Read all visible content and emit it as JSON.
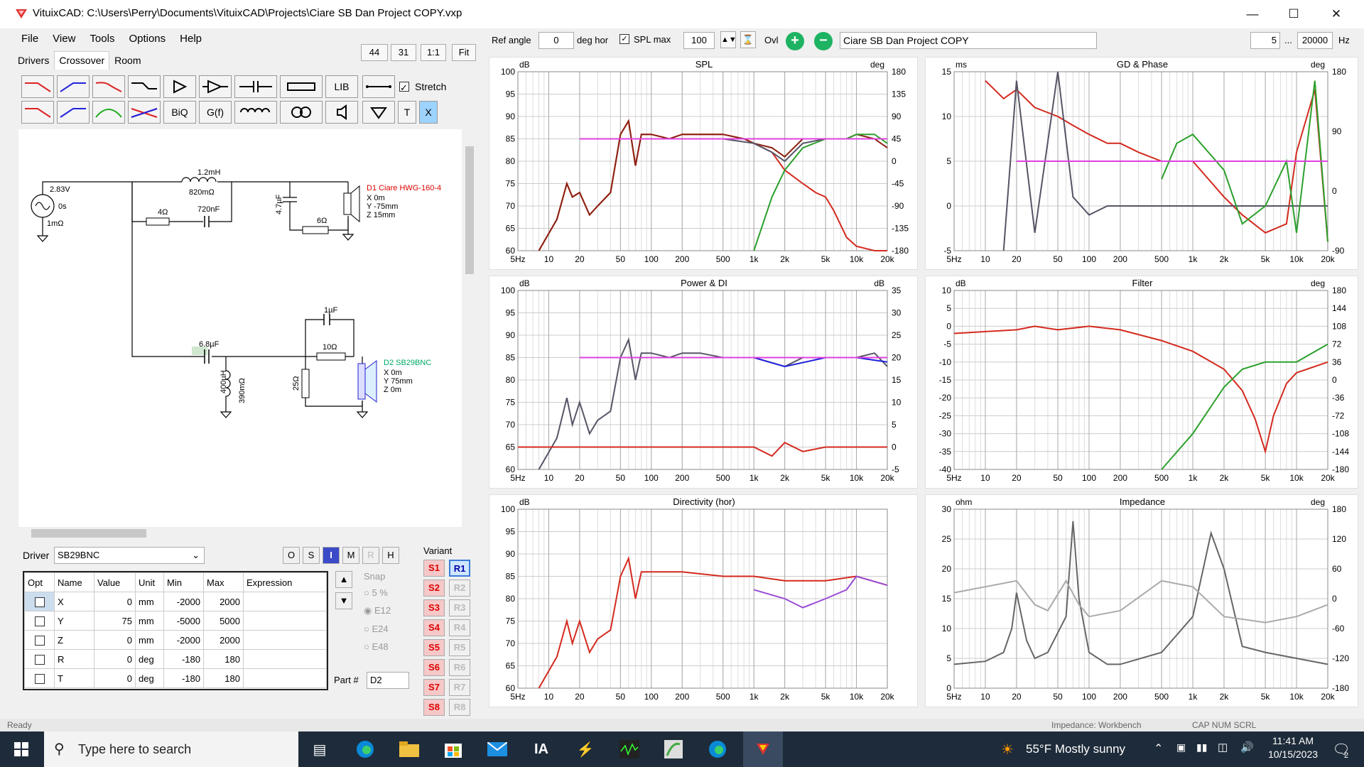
{
  "window": {
    "title": "VituixCAD: C:\\Users\\Perry\\Documents\\VituixCAD\\Projects\\Ciare SB Dan Project COPY.vxp"
  },
  "menu": [
    "File",
    "View",
    "Tools",
    "Options",
    "Help"
  ],
  "tabs": [
    "Drivers",
    "Crossover",
    "Room"
  ],
  "zoom": {
    "a": "44",
    "b": "31",
    "one": "1:1",
    "fit": "Fit"
  },
  "toolbar": {
    "lib": "LIB",
    "stretch": "Stretch",
    "biq": "BiQ",
    "gf": "G(f)",
    "t": "T",
    "x": "X"
  },
  "topbar": {
    "ref_angle_label": "Ref angle",
    "ref_angle_value": "0",
    "deg_hor": "deg hor",
    "spl_max_label": "SPL max",
    "spl_max_value": "100",
    "ovl": "Ovl",
    "project_name": "Ciare SB Dan Project COPY",
    "freq_min": "5",
    "ellipsis": "...",
    "freq_max": "20000",
    "hz": "Hz"
  },
  "schematic": {
    "source": {
      "v": "2.83V",
      "phase": "0s",
      "r": "1mΩ"
    },
    "upper": {
      "l1": "1.2mH",
      "l1r": "820mΩ",
      "r1": "4Ω",
      "c1": "720nF",
      "c2": "4.7µF",
      "r2": "6Ω"
    },
    "d1": {
      "name": "D1 Ciare HWG-160-4",
      "x": "X 0m",
      "y": "Y -75mm",
      "z": "Z 15mm"
    },
    "lower": {
      "c1": "6.8µF",
      "l1": "400µH",
      "l1r": "390mΩ",
      "c2": "1µF",
      "r1": "10Ω",
      "r2": "25Ω"
    },
    "d2": {
      "name": "D2 SB29BNC",
      "x": "X 0m",
      "y": "Y 75mm",
      "z": "Z 0m"
    }
  },
  "driver_panel": {
    "label": "Driver",
    "selected": "SB29BNC",
    "buttons": [
      "O",
      "S",
      "I",
      "M",
      "R",
      "H"
    ]
  },
  "param_table": {
    "headers": [
      "Opt",
      "Name",
      "Value",
      "Unit",
      "Min",
      "Max",
      "Expression"
    ],
    "rows": [
      {
        "name": "X",
        "value": "0",
        "unit": "mm",
        "min": "-2000",
        "max": "2000"
      },
      {
        "name": "Y",
        "value": "75",
        "unit": "mm",
        "min": "-5000",
        "max": "5000"
      },
      {
        "name": "Z",
        "value": "0",
        "unit": "mm",
        "min": "-2000",
        "max": "2000"
      },
      {
        "name": "R",
        "value": "0",
        "unit": "deg",
        "min": "-180",
        "max": "180"
      },
      {
        "name": "T",
        "value": "0",
        "unit": "deg",
        "min": "-180",
        "max": "180"
      }
    ]
  },
  "snap": {
    "label": "Snap",
    "options": [
      "5 %",
      "E12",
      "E24",
      "E48"
    ],
    "selected": "E12"
  },
  "part": {
    "label": "Part #",
    "value": "D2"
  },
  "variant": {
    "label": "Variant",
    "s": [
      "S1",
      "S2",
      "S3",
      "S4",
      "S5",
      "S6",
      "S7",
      "S8"
    ],
    "r": [
      "R1",
      "R2",
      "R3",
      "R4",
      "R5",
      "R6",
      "R7",
      "R8"
    ]
  },
  "status": {
    "left": "Ready",
    "mid": "Impedance: Workbench",
    "right": "CAP  NUM  SCRL"
  },
  "taskbar": {
    "search": "Type here to search",
    "weather": "55°F  Mostly sunny",
    "time": "11:41 AM",
    "date": "10/15/2023",
    "notif": "2"
  },
  "colors": {
    "red": "#d42a1f",
    "green": "#2ca02c",
    "gray": "#555566",
    "magenta": "#e040e0",
    "blue": "#2222dd"
  },
  "chart_data": [
    {
      "type": "line",
      "title": "SPL",
      "ylabel": "dB",
      "y2label": "deg",
      "ylim": [
        60,
        100
      ],
      "y2lim": [
        -180,
        180
      ],
      "xscale": "log",
      "xlim": [
        5,
        20000
      ],
      "xticks": [
        "5Hz",
        "10",
        "20",
        "50",
        "100",
        "200",
        "500",
        "1k",
        "2k",
        "5k",
        "10k",
        "20k"
      ],
      "yticks": [
        "100",
        "95",
        "90",
        "85",
        "80",
        "75",
        "70",
        "65",
        "60"
      ],
      "y2ticks": [
        "180",
        "135",
        "90",
        "45",
        "0",
        "-45",
        "-90",
        "-135",
        "-180"
      ],
      "series": [
        {
          "color": "red",
          "x": [
            8,
            12,
            15,
            17,
            20,
            25,
            30,
            40,
            50,
            60,
            70,
            80,
            100,
            150,
            200,
            300,
            500,
            800,
            1000,
            1500,
            2000,
            3000,
            4000,
            5000,
            6000,
            8000,
            10000,
            15000,
            20000
          ],
          "y": [
            60,
            67,
            75,
            72,
            73,
            68,
            70,
            73,
            86,
            89,
            79,
            86,
            86,
            85,
            86,
            86,
            86,
            85,
            84,
            82,
            78,
            75,
            73,
            72,
            69,
            63,
            61,
            60,
            60
          ]
        },
        {
          "color": "darkred",
          "x": [
            8,
            12,
            15,
            17,
            20,
            25,
            30,
            40,
            50,
            60,
            70,
            80,
            100,
            150,
            200,
            300,
            500,
            800,
            1000,
            1500,
            2000,
            3000,
            5000,
            8000,
            10000,
            15000,
            20000
          ],
          "y": [
            60,
            67,
            75,
            72,
            73,
            68,
            70,
            73,
            86,
            89,
            79,
            86,
            86,
            85,
            86,
            86,
            86,
            85,
            84,
            83,
            81,
            85,
            85,
            85,
            86,
            85,
            83
          ]
        },
        {
          "color": "green",
          "x": [
            1000,
            1500,
            2000,
            3000,
            5000,
            8000,
            10000,
            15000,
            20000
          ],
          "y": [
            60,
            72,
            78,
            83,
            85,
            85,
            86,
            86,
            84
          ]
        },
        {
          "color": "gray",
          "x": [
            500,
            1000,
            1500,
            2000,
            3000,
            5000,
            8000
          ],
          "y": [
            85,
            84,
            82,
            80,
            84,
            85,
            85
          ]
        },
        {
          "color": "magenta",
          "x": [
            20,
            20000
          ],
          "y": [
            85,
            85
          ]
        }
      ]
    },
    {
      "type": "line",
      "title": "GD & Phase",
      "ylabel": "ms",
      "y2label": "deg",
      "ylim": [
        -5,
        15
      ],
      "y2lim": [
        -180,
        180
      ],
      "xscale": "log",
      "xlim": [
        5,
        20000
      ],
      "xticks": [
        "5Hz",
        "10",
        "20",
        "50",
        "100",
        "200",
        "500",
        "1k",
        "2k",
        "5k",
        "10k",
        "20k"
      ],
      "yticks": [
        "15",
        "10",
        "5",
        "0",
        "-5"
      ],
      "y2ticks": [
        "180",
        "90",
        "0",
        "-90"
      ],
      "series": [
        {
          "color": "red",
          "x": [
            10,
            15,
            20,
            30,
            50,
            70,
            100,
            150,
            200,
            300,
            500,
            1000,
            2000,
            3000,
            5000,
            8000,
            10000,
            15000,
            20000
          ],
          "y": [
            14,
            12,
            13,
            11,
            10,
            9,
            8,
            7,
            7,
            6,
            5,
            5,
            1,
            -1,
            -3,
            -2,
            6,
            13,
            -4
          ]
        },
        {
          "color": "gray",
          "x": [
            15,
            20,
            30,
            50,
            70,
            100,
            150,
            200,
            300,
            500,
            1000,
            2000,
            5000,
            10000,
            20000
          ],
          "y": [
            -5,
            14,
            -3,
            15,
            1,
            -1,
            0,
            0,
            0,
            0,
            0,
            0,
            0,
            0,
            0
          ]
        },
        {
          "color": "green",
          "x": [
            500,
            700,
            1000,
            2000,
            3000,
            5000,
            8000,
            10000,
            15000,
            20000
          ],
          "y": [
            3,
            7,
            8,
            4,
            -2,
            0,
            5,
            -3,
            14,
            -4
          ]
        },
        {
          "color": "magenta",
          "x": [
            20,
            20000
          ],
          "y": [
            5,
            5
          ]
        }
      ]
    },
    {
      "type": "line",
      "title": "Power & DI",
      "ylabel": "dB",
      "y2label": "dB",
      "ylim": [
        60,
        100
      ],
      "y2lim": [
        -5,
        35
      ],
      "xscale": "log",
      "xlim": [
        5,
        20000
      ],
      "xticks": [
        "5Hz",
        "10",
        "20",
        "50",
        "100",
        "200",
        "500",
        "1k",
        "2k",
        "5k",
        "10k",
        "20k"
      ],
      "yticks": [
        "100",
        "95",
        "90",
        "85",
        "80",
        "75",
        "70",
        "65",
        "60"
      ],
      "y2ticks": [
        "35",
        "30",
        "25",
        "20",
        "15",
        "10",
        "5",
        "0",
        "-5"
      ],
      "series": [
        {
          "color": "gray",
          "x": [
            8,
            12,
            15,
            17,
            20,
            25,
            30,
            40,
            50,
            60,
            70,
            80,
            100,
            150,
            200,
            300,
            500,
            1000,
            2000,
            3000,
            5000,
            10000,
            15000,
            20000
          ],
          "y": [
            60,
            67,
            76,
            70,
            75,
            68,
            71,
            73,
            85,
            89,
            80,
            86,
            86,
            85,
            86,
            86,
            85,
            85,
            83,
            85,
            85,
            85,
            86,
            83
          ]
        },
        {
          "color": "blue",
          "x": [
            1000,
            2000,
            5000,
            10000,
            20000
          ],
          "y": [
            85,
            83,
            85,
            85,
            84
          ]
        },
        {
          "color": "red",
          "x": [
            5,
            500,
            800,
            1000,
            1500,
            2000,
            3000,
            5000,
            10000,
            20000
          ],
          "y": [
            65,
            65,
            65,
            65,
            63,
            66,
            64,
            65,
            65,
            65
          ]
        },
        {
          "color": "magenta",
          "x": [
            20,
            20000
          ],
          "y": [
            85,
            85
          ]
        }
      ]
    },
    {
      "type": "line",
      "title": "Filter",
      "ylabel": "dB",
      "y2label": "deg",
      "ylim": [
        -40,
        10
      ],
      "y2lim": [
        -180,
        180
      ],
      "xscale": "log",
      "xlim": [
        5,
        20000
      ],
      "xticks": [
        "5Hz",
        "10",
        "20",
        "50",
        "100",
        "200",
        "500",
        "1k",
        "2k",
        "5k",
        "10k",
        "20k"
      ],
      "yticks": [
        "10",
        "5",
        "0",
        "-5",
        "-10",
        "-15",
        "-20",
        "-25",
        "-30",
        "-35",
        "-40"
      ],
      "y2ticks": [
        "180",
        "144",
        "108",
        "72",
        "36",
        "0",
        "-36",
        "-72",
        "-108",
        "-144",
        "-180"
      ],
      "series": [
        {
          "color": "red",
          "x": [
            5,
            20,
            30,
            50,
            100,
            200,
            500,
            1000,
            2000,
            3000,
            4000,
            5000,
            6000,
            8000,
            10000,
            20000
          ],
          "y": [
            -2,
            -1,
            0,
            -1,
            0,
            -1,
            -4,
            -7,
            -12,
            -18,
            -26,
            -35,
            -25,
            -16,
            -13,
            -10
          ]
        },
        {
          "color": "green",
          "x": [
            500,
            1000,
            2000,
            3000,
            5000,
            10000,
            20000
          ],
          "y": [
            -40,
            -30,
            -17,
            -12,
            -10,
            -10,
            -5
          ]
        }
      ]
    },
    {
      "type": "line",
      "title": "Directivity (hor)",
      "ylabel": "dB",
      "ylim": [
        60,
        100
      ],
      "xscale": "log",
      "xlim": [
        5,
        20000
      ],
      "xticks": [
        "5Hz",
        "10",
        "20",
        "50",
        "100",
        "200",
        "500",
        "1k",
        "2k",
        "5k",
        "10k",
        "20k"
      ],
      "yticks": [
        "100",
        "95",
        "90",
        "85",
        "80",
        "75",
        "70",
        "65",
        "60"
      ],
      "series": [
        {
          "color": "red",
          "x": [
            8,
            12,
            15,
            17,
            20,
            25,
            30,
            40,
            50,
            60,
            70,
            80,
            100,
            200,
            500,
            1000,
            2000,
            5000,
            10000,
            20000
          ],
          "y": [
            60,
            67,
            75,
            70,
            75,
            68,
            71,
            73,
            85,
            89,
            80,
            86,
            86,
            86,
            85,
            85,
            84,
            84,
            85,
            83
          ]
        },
        {
          "color": "multi",
          "x": [
            1000,
            2000,
            3000,
            5000,
            8000,
            10000,
            20000
          ],
          "y": [
            82,
            80,
            78,
            80,
            82,
            85,
            83
          ]
        }
      ]
    },
    {
      "type": "line",
      "title": "Impedance",
      "ylabel": "ohm",
      "y2label": "deg",
      "ylim": [
        0,
        30
      ],
      "y2lim": [
        -180,
        180
      ],
      "xscale": "log",
      "xlim": [
        5,
        20000
      ],
      "xticks": [
        "5Hz",
        "10",
        "20",
        "50",
        "100",
        "200",
        "500",
        "1k",
        "2k",
        "5k",
        "10k",
        "20k"
      ],
      "yticks": [
        "30",
        "25",
        "20",
        "15",
        "10",
        "5",
        "0"
      ],
      "y2ticks": [
        "180",
        "120",
        "60",
        "0",
        "-60",
        "-120",
        "-180"
      ],
      "series": [
        {
          "color": "darkgray",
          "x": [
            5,
            10,
            15,
            18,
            20,
            25,
            30,
            40,
            60,
            70,
            80,
            100,
            150,
            200,
            500,
            1000,
            1500,
            2000,
            3000,
            5000,
            10000,
            20000
          ],
          "y": [
            4,
            4.5,
            6,
            10,
            16,
            8,
            5,
            6,
            12,
            28,
            15,
            6,
            4,
            4,
            6,
            12,
            26,
            20,
            7,
            6,
            5,
            4
          ]
        },
        {
          "color": "lightgray",
          "x": [
            5,
            10,
            20,
            30,
            40,
            60,
            80,
            100,
            200,
            500,
            1000,
            2000,
            5000,
            10000,
            20000
          ],
          "y": [
            16,
            17,
            18,
            14,
            13,
            18,
            14,
            12,
            13,
            18,
            17,
            12,
            11,
            12,
            14
          ]
        }
      ]
    }
  ]
}
